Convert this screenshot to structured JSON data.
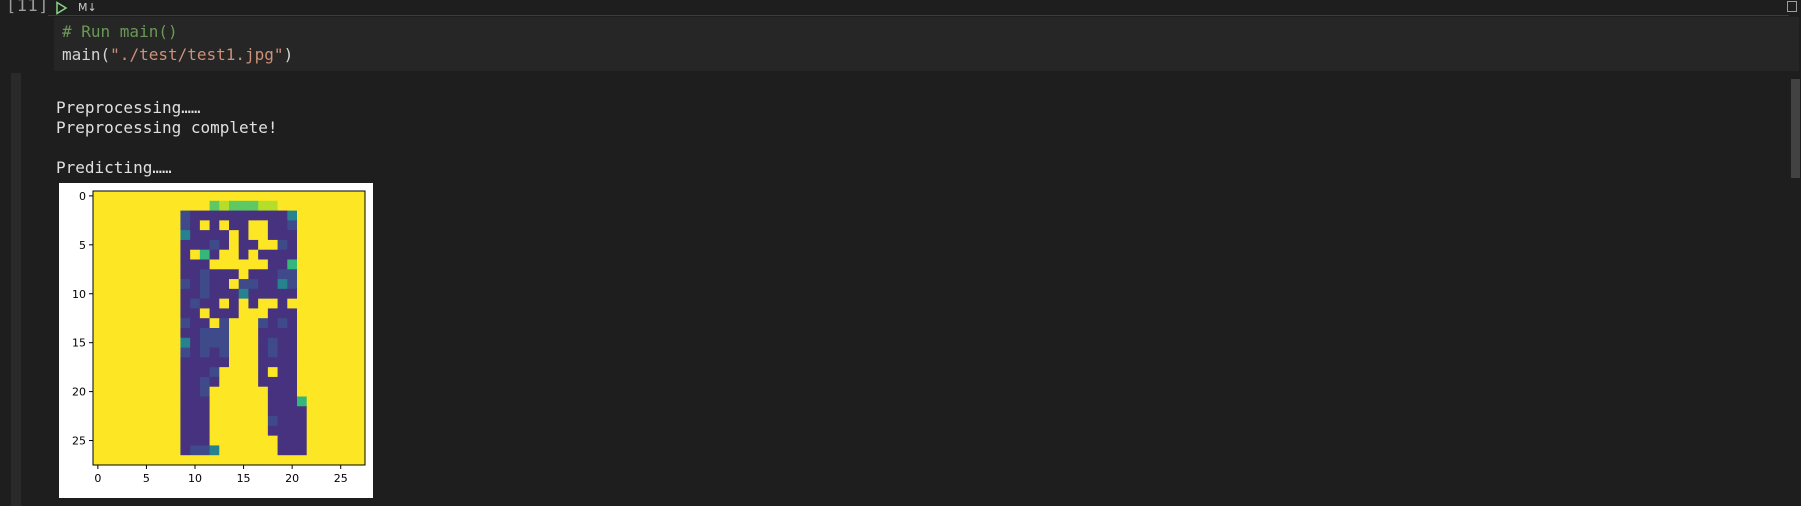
{
  "cell": {
    "execution_count": "[11]",
    "toolbar": {
      "run_icon": "run-triangle-icon",
      "markdown_label": "M↓",
      "trash_icon": "delete-cell-icon"
    },
    "code": {
      "line1": "# Run main()",
      "line2_func": "main(",
      "line2_string": "\"./test/test1.jpg\"",
      "line2_close": ")"
    }
  },
  "output": {
    "lines": [
      "Preprocessing……",
      "Preprocessing complete!",
      "Predicting……"
    ]
  },
  "colors": {
    "background": "#1e1e1e",
    "code_background": "#262626",
    "comment": "#6a9955",
    "string": "#ce9178",
    "text": "#d4d4d4",
    "run_icon": "#89d185",
    "image_background": "#fde725"
  },
  "chart_data": {
    "type": "heatmap",
    "title": "",
    "colormap": "viridis",
    "grid": false,
    "x_ticks": [
      "0",
      "5",
      "10",
      "15",
      "20",
      "25"
    ],
    "y_ticks": [
      "0",
      "5",
      "10",
      "15",
      "20",
      "25"
    ],
    "xlim": [
      -0.5,
      27.5
    ],
    "ylim": [
      27.5,
      -0.5
    ],
    "description_of_cells": "28x28 inverted grayscale image of trousers; background value 1.0 (yellow), garment pixels in the dark purple/blue/teal range",
    "rows": [
      "1111111111111111111111111111",
      "1111111111116766677111111111",
      "1111111113222222222241111111",
      "1111111113212122112231111111",
      "1111111114222212112221111111",
      "1111111112223212211321111111",
      "1111111112152112122221111111",
      "1111111112221111112251111111",
      "1111111112232221222331111111",
      "1111111113232213322431111111",
      "1111111112232224222221111111",
      "1111111112322121211211111111",
      "1111111112212221112221111111",
      "1111111113221311132321111111",
      "1111111112233311122221111111",
      "1111111114233311123221111111",
      "1111111113232311123221111111",
      "1111111112222211122221111111",
      "1111111112223111121221111111",
      "1111111112232111122221111111",
      "1111111112231111112221111111",
      "1111111112221111112225111111",
      "1111111112221111112222111111",
      "1111111112221111113222111111",
      "1111111112221111112222111111",
      "1111111112221111111222111111",
      "1111111112334111111222111111",
      "1111111111111111111111111111"
    ]
  }
}
